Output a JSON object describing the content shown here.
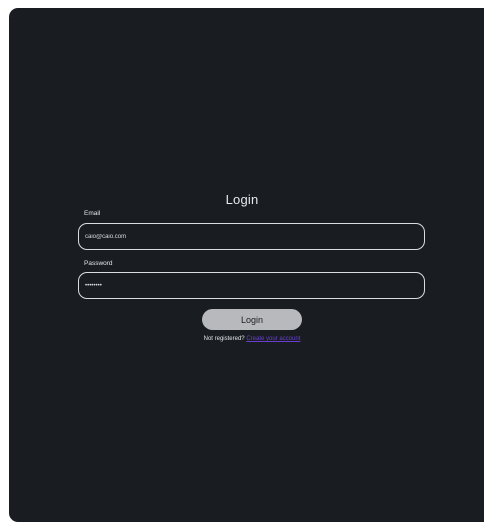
{
  "login": {
    "title": "Login",
    "email_label": "Email",
    "email_value": "caio@caio.com",
    "password_label": "Password",
    "password_value": "12345678",
    "button_label": "Login",
    "register_prompt": "Not registered?",
    "register_link": "Create your account"
  },
  "colors": {
    "background": "#191d22",
    "button": "#b7b9bc",
    "link": "#6a3fd0",
    "input_border": "#d9dce0"
  }
}
